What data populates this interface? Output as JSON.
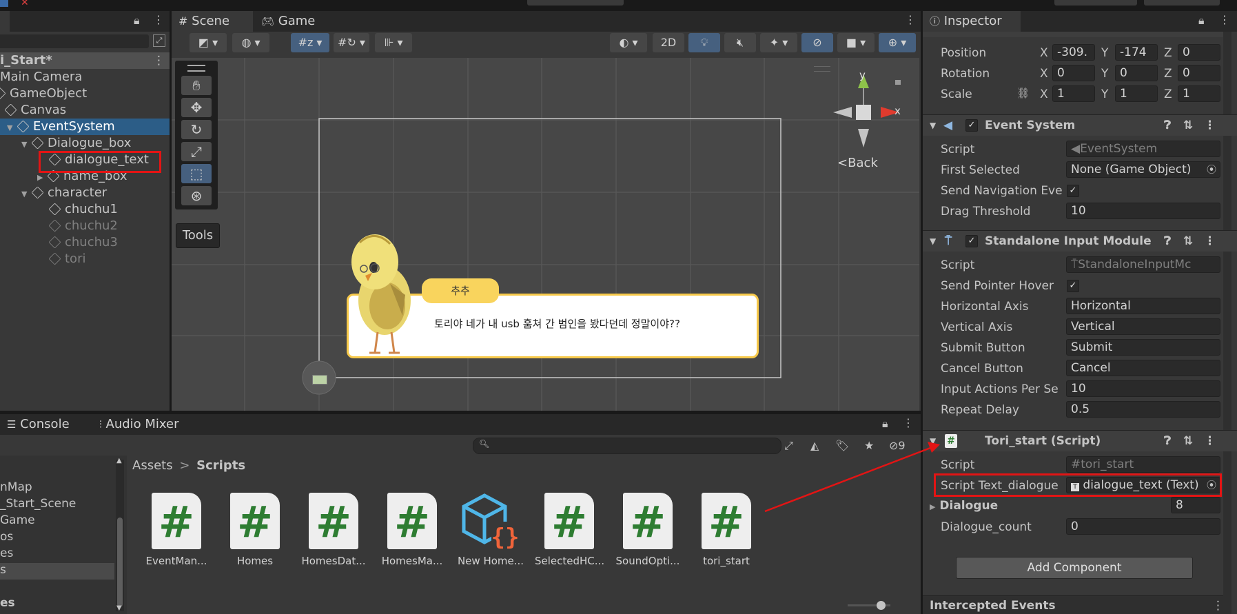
{
  "hierarchy": {
    "scene": "i_Start*",
    "items": [
      {
        "label": "Main Camera"
      },
      {
        "label": "GameObject"
      },
      {
        "label": "Canvas"
      },
      {
        "label": "EventSystem"
      },
      {
        "label": "Dialogue_box"
      },
      {
        "label": "dialogue_text"
      },
      {
        "label": "name_box"
      },
      {
        "label": "character"
      },
      {
        "label": "chuchu1"
      },
      {
        "label": "chuchu2"
      },
      {
        "label": "chuchu3"
      },
      {
        "label": "tori"
      }
    ]
  },
  "scene": {
    "tabs": {
      "scene": "Scene",
      "game": "Game"
    },
    "btn_2d": "2D",
    "tools_label": "Tools",
    "back_label": "Back",
    "gizmo_y": "y",
    "gizmo_x": "x",
    "name_tag": "추추",
    "dialogue": "토리야 네가 내 usb 훔쳐 간 범인을 봤다던데 정말이야??"
  },
  "inspector": {
    "tab": "Inspector",
    "transform": {
      "position_label": "Position",
      "pos_x": "-309.",
      "pos_y": "-174",
      "pos_z": "0",
      "rotation_label": "Rotation",
      "rot_x": "0",
      "rot_y": "0",
      "rot_z": "0",
      "scale_label": "Scale",
      "scale_x": "1",
      "scale_y": "1",
      "scale_z": "1",
      "x": "X",
      "y": "Y",
      "z": "Z"
    },
    "event_system": {
      "title": "Event System",
      "script_label": "Script",
      "script_val": "EventSystem",
      "first_selected_label": "First Selected",
      "first_selected_val": "None (Game Object)",
      "send_nav_label": "Send Navigation Eve",
      "drag_label": "Drag Threshold",
      "drag_val": "10"
    },
    "standalone": {
      "title": "Standalone Input Module",
      "script_label": "Script",
      "script_val": "StandaloneInputMc",
      "hover_label": "Send Pointer Hover",
      "h_axis_label": "Horizontal Axis",
      "h_axis_val": "Horizontal",
      "v_axis_label": "Vertical Axis",
      "v_axis_val": "Vertical",
      "submit_label": "Submit Button",
      "submit_val": "Submit",
      "cancel_label": "Cancel Button",
      "cancel_val": "Cancel",
      "actions_label": "Input Actions Per Se",
      "actions_val": "10",
      "repeat_label": "Repeat Delay",
      "repeat_val": "0.5"
    },
    "tori_start": {
      "title": "Tori_start (Script)",
      "script_label": "Script",
      "script_val": "tori_start",
      "text_label": "Script Text_dialogue",
      "text_val": "dialogue_text (Text)",
      "dialogue_label": "Dialogue",
      "dialogue_val": "8",
      "count_label": "Dialogue_count",
      "count_val": "0"
    },
    "add_component": "Add Component",
    "intercepted": "Intercepted Events"
  },
  "bottom": {
    "tabs": {
      "console": "Console",
      "audio": "Audio Mixer"
    },
    "hidden_count": "9",
    "breadcrumb": {
      "root": "Assets",
      "sep": ">",
      "current": "Scripts"
    },
    "folders": [
      "nMap",
      "_Start_Scene",
      "Game",
      "os",
      "es",
      "s",
      "es"
    ],
    "assets": [
      {
        "label": "EventMan..."
      },
      {
        "label": "Homes"
      },
      {
        "label": "HomesDat..."
      },
      {
        "label": "HomesMa..."
      },
      {
        "label": "New Home..."
      },
      {
        "label": "SelectedHC..."
      },
      {
        "label": "SoundOpti..."
      },
      {
        "label": "tori_start"
      }
    ],
    "hash": "#"
  }
}
